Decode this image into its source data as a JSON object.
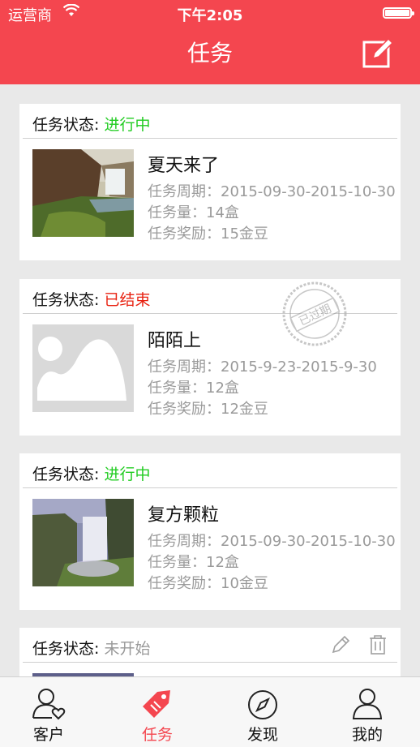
{
  "status_bar": {
    "carrier": "运营商",
    "time": "下午2:05"
  },
  "nav": {
    "title": "任务"
  },
  "colors": {
    "accent": "#f4464f",
    "in_progress": "#22cc22",
    "ended": "#e8200f",
    "not_started": "#999999"
  },
  "tasks": [
    {
      "status_label": "任务状态:",
      "status": "进行中",
      "name": "夏天来了",
      "period": "任务周期：2015-09-30-2015-10-30",
      "amount": "任务量：14盒",
      "reward": "任务奖励：15金豆"
    },
    {
      "status_label": "任务状态:",
      "status": "已结束",
      "name": "陌陌上",
      "period": "任务周期：2015-9-23-2015-9-30",
      "amount": "任务量：12盒",
      "reward": "任务奖励：12金豆",
      "stamp": "已过期"
    },
    {
      "status_label": "任务状态:",
      "status": "进行中",
      "name": "复方颗粒",
      "period": "任务周期：2015-09-30-2015-10-30",
      "amount": "任务量：12盒",
      "reward": "任务奖励：10金豆"
    },
    {
      "status_label": "任务状态:",
      "status": "未开始"
    }
  ],
  "tabs": [
    {
      "label": "客户",
      "icon": "customer-icon"
    },
    {
      "label": "任务",
      "icon": "task-tag-icon",
      "active": true
    },
    {
      "label": "发现",
      "icon": "compass-icon"
    },
    {
      "label": "我的",
      "icon": "user-icon"
    }
  ]
}
